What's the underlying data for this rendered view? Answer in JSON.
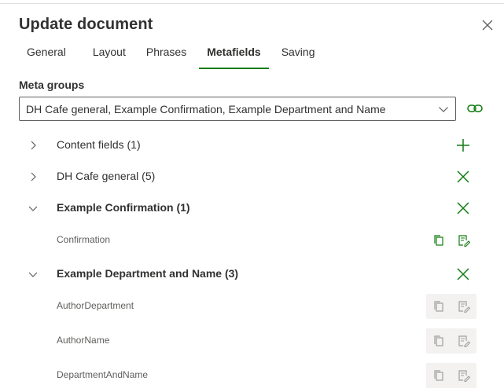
{
  "panel": {
    "title": "Update document",
    "close_icon": "close-icon"
  },
  "tabs": [
    {
      "label": "General",
      "active": false
    },
    {
      "label": "Layout",
      "active": false
    },
    {
      "label": "Phrases",
      "active": false
    },
    {
      "label": "Metafields",
      "active": true
    },
    {
      "label": "Saving",
      "active": false
    }
  ],
  "meta_groups": {
    "label": "Meta groups",
    "selected": "DH Cafe general, Example Confirmation, Example Department and Name",
    "link_icon": "link-icon"
  },
  "groups": [
    {
      "label": "Content fields (1)",
      "expanded": false,
      "action": "add-icon"
    },
    {
      "label": "DH Cafe general (5)",
      "expanded": false,
      "action": "remove-icon"
    },
    {
      "label": "Example Confirmation (1)",
      "expanded": true,
      "action": "remove-icon",
      "fields": [
        {
          "label": "Confirmation",
          "enabled": true
        }
      ]
    },
    {
      "label": "Example Department and Name (3)",
      "expanded": true,
      "action": "remove-icon",
      "fields": [
        {
          "label": "AuthorDepartment",
          "enabled": false
        },
        {
          "label": "AuthorName",
          "enabled": false
        },
        {
          "label": "DepartmentAndName",
          "enabled": false
        }
      ]
    }
  ],
  "colors": {
    "accent": "#107c10",
    "disabled_icon": "#a19f9d",
    "disabled_bg": "#f3f2f1"
  }
}
